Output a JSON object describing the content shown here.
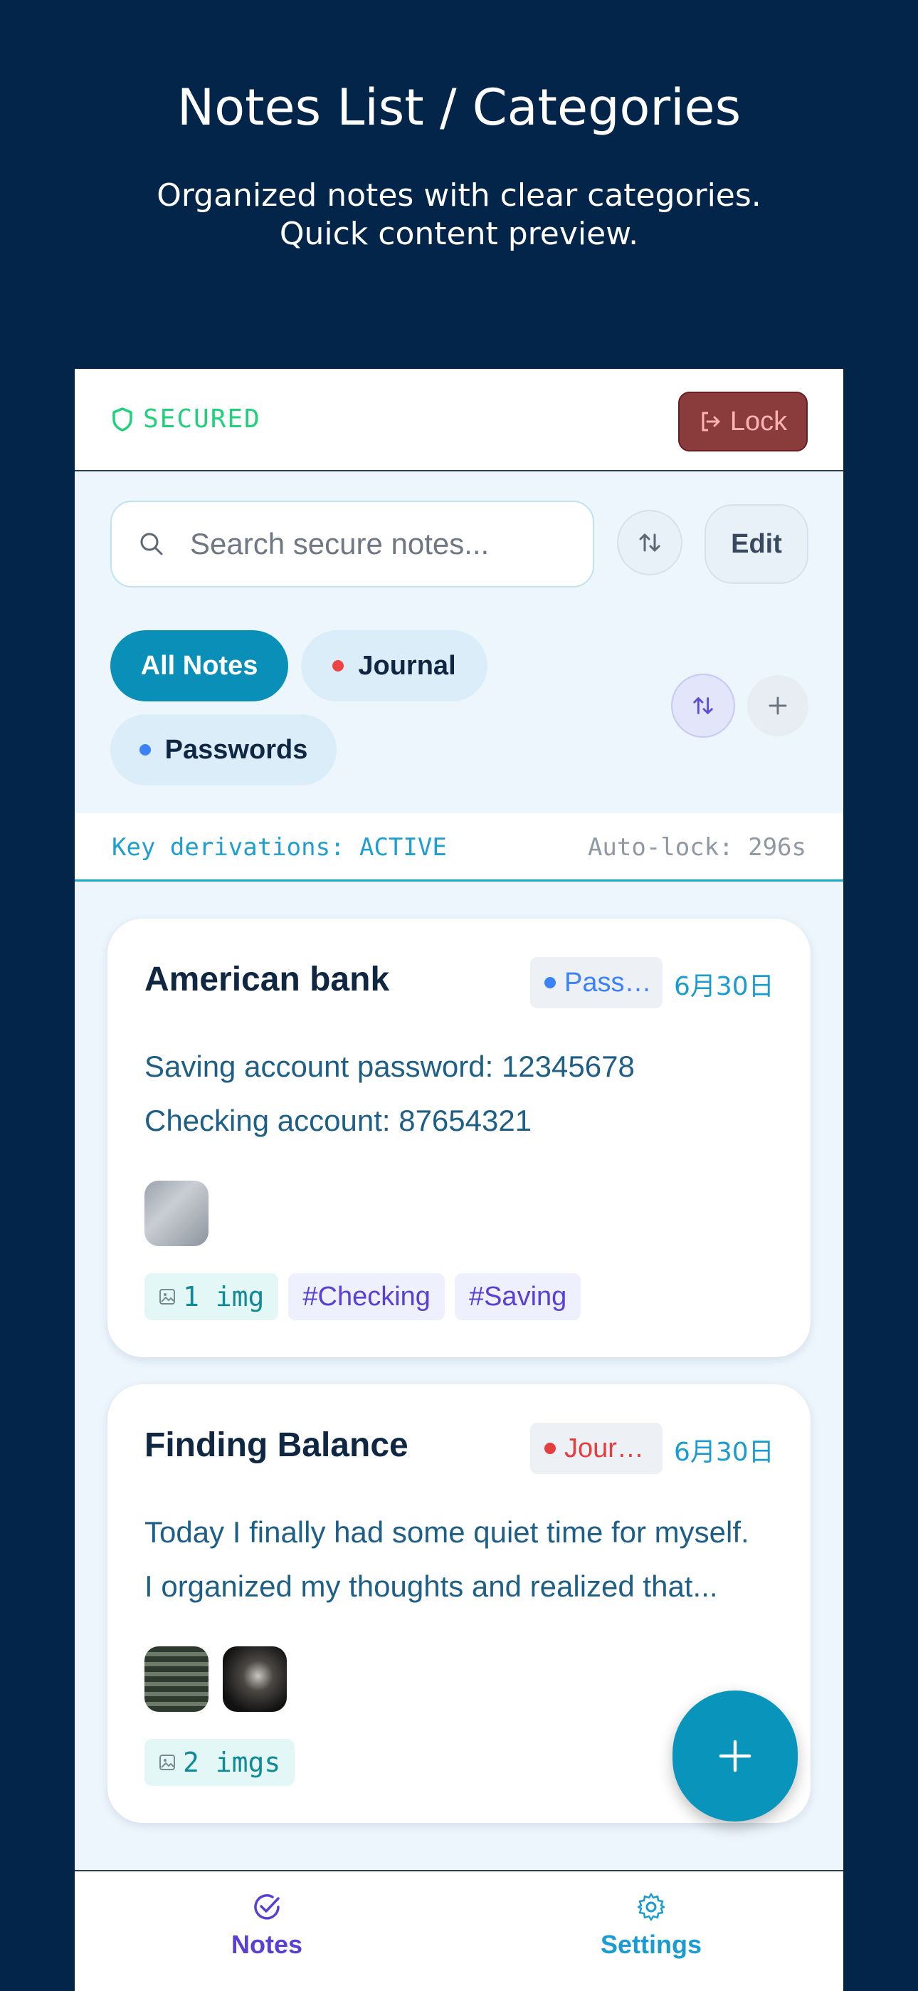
{
  "hero": {
    "title": "Notes List / Categories",
    "subtitle_line1": "Organized notes with clear categories.",
    "subtitle_line2": "Quick content preview."
  },
  "topbar": {
    "status": "SECURED",
    "lock_label": "Lock"
  },
  "search": {
    "placeholder": "Search secure notes..."
  },
  "toolbar": {
    "edit_label": "Edit"
  },
  "categories": [
    {
      "label": "All Notes",
      "active": true
    },
    {
      "label": "Journal",
      "dot_color": "#ef4444"
    },
    {
      "label": "Passwords",
      "dot_color": "#3b82f6"
    }
  ],
  "keybar": {
    "left": "Key derivations: ACTIVE",
    "right": "Auto-lock: 296s"
  },
  "notes": [
    {
      "title": "American bank",
      "category": "Pass…",
      "category_color": "#3b82f6",
      "date": "6月30日",
      "body_line1": "Saving account password: 12345678",
      "body_line2": "Checking account: 87654321",
      "img_count": "1 img",
      "tags": [
        "#Checking",
        "#Saving"
      ]
    },
    {
      "title": "Finding Balance",
      "category": "Jour…",
      "category_color": "#e53e3e",
      "date": "6月30日",
      "body_line1": "Today I finally had some quiet time for myself.",
      "body_line2": "I organized my thoughts and realized that...",
      "img_count": "2 imgs",
      "tags": []
    }
  ],
  "bottomnav": {
    "notes_label": "Notes",
    "settings_label": "Settings"
  }
}
